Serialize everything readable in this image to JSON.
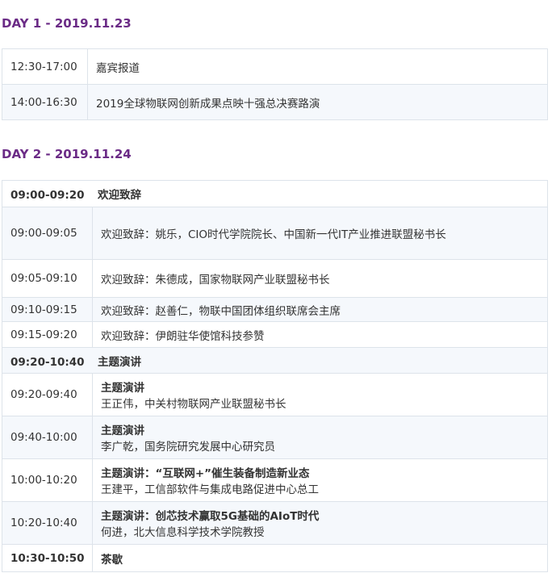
{
  "day1": {
    "heading": "DAY 1 - 2019.11.23",
    "rows": [
      {
        "time": "12:30-17:00",
        "text": "嘉宾报道"
      },
      {
        "time": "14:00-16:30",
        "text": "2019全球物联网创新成果点映十强总决赛路演"
      }
    ]
  },
  "day2": {
    "heading": "DAY 2 - 2019.11.24",
    "rows": [
      {
        "time": "09:00-09:20",
        "text": "欢迎致辞"
      },
      {
        "time": "09:00-09:05",
        "text": "欢迎致辞：姚乐，CIO时代学院院长、中国新一代IT产业推进联盟秘书长"
      },
      {
        "time": "09:05-09:10",
        "text": "欢迎致辞：朱德成，国家物联网产业联盟秘书长"
      },
      {
        "time": "09:10-09:15",
        "text": "欢迎致辞：赵善仁，物联中国团体组织联席会主席"
      },
      {
        "time": "09:15-09:20",
        "text": "欢迎致辞：伊朗驻华使馆科技参赞"
      },
      {
        "time": "09:20-10:40",
        "text": "主题演讲"
      },
      {
        "time": "09:20-09:40",
        "title": "主题演讲",
        "text": "王正伟，中关村物联网产业联盟秘书长"
      },
      {
        "time": "09:40-10:00",
        "title": "主题演讲",
        "text": "李广乾，国务院研究发展中心研究员"
      },
      {
        "time": "10:00-10:20",
        "title": "主题演讲：“互联网+”催生装备制造新业态",
        "text": "王建平，工信部软件与集成电路促进中心总工"
      },
      {
        "time": "10:20-10:40",
        "title": "主题演讲：创芯技术赢取5G基础的AIoT时代",
        "text": "何进，北大信息科学技术学院教授"
      },
      {
        "time": "10:30-10:50",
        "text": "茶歇"
      }
    ]
  }
}
